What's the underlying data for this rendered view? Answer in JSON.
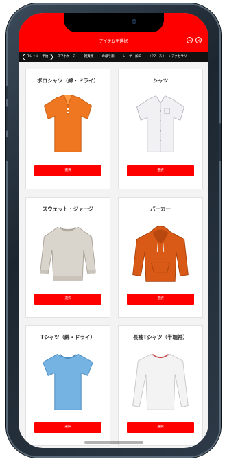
{
  "colors": {
    "accent": "#ff0000",
    "tab_bar": "#111111",
    "card_bg": "#ffffff",
    "content_bg": "#f3f3f3"
  },
  "header": {
    "title": "アイテムを選択",
    "icons": {
      "minimize": "minus-circle-icon",
      "close": "close-circle-icon"
    }
  },
  "tabs": [
    {
      "label": "Tシャツ・半袖",
      "active": true
    },
    {
      "label": "スマホケース",
      "active": false
    },
    {
      "label": "雑貨類",
      "active": false
    },
    {
      "label": "のぼり旗",
      "active": false
    },
    {
      "label": "レーザー加工",
      "active": false
    },
    {
      "label": "パワーストーンアクセサリー",
      "active": false
    }
  ],
  "products": [
    {
      "name": "ポロシャツ（綿・ドライ）",
      "button": "選択",
      "icon": "polo-shirt-orange-icon",
      "color": "#ef7722"
    },
    {
      "name": "シャツ",
      "button": "選択",
      "icon": "dress-shirt-white-icon",
      "color": "#f1f1f4"
    },
    {
      "name": "スウェット・ジャージ",
      "button": "選択",
      "icon": "sweatshirt-gray-icon",
      "color": "#d9d4cc"
    },
    {
      "name": "パーカー",
      "button": "選択",
      "icon": "hoodie-orange-icon",
      "color": "#d95a16"
    },
    {
      "name": "Tシャツ（綿・ドライ）",
      "button": "選択",
      "icon": "tshirt-lightblue-icon",
      "color": "#74b3e2"
    },
    {
      "name": "長袖Tシャツ（半端袖）",
      "button": "選択",
      "icon": "long-sleeve-tshirt-white-icon",
      "color": "#f3f3f3"
    }
  ]
}
